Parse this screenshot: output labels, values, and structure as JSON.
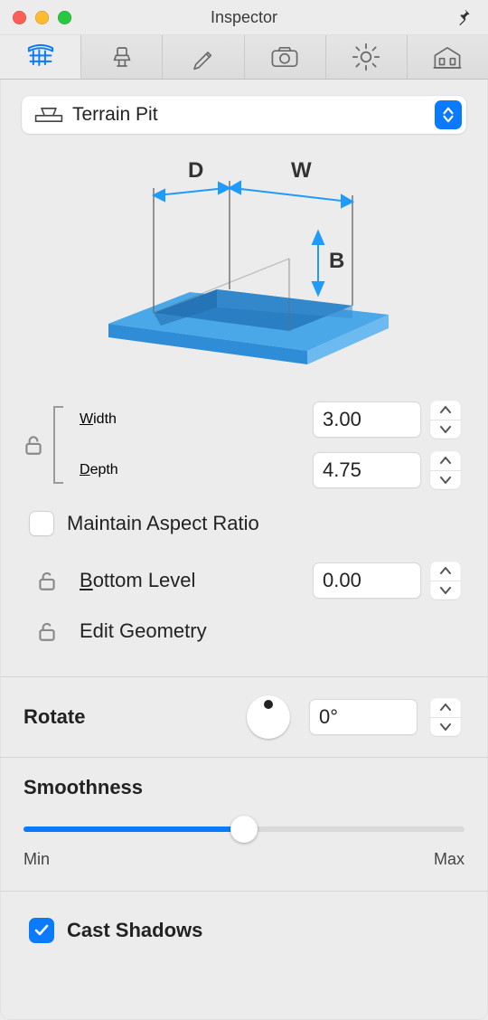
{
  "window": {
    "title": "Inspector"
  },
  "object": {
    "name": "Terrain Pit"
  },
  "diagram": {
    "d_label": "D",
    "w_label": "W",
    "b_label": "B"
  },
  "width": {
    "label_pre": "W",
    "label_rest": "idth",
    "value": "3.00"
  },
  "depth": {
    "label_pre": "D",
    "label_rest": "epth",
    "value": "4.75"
  },
  "aspect": {
    "label": "Maintain Aspect Ratio",
    "checked": false
  },
  "bottom": {
    "label_pre": "B",
    "label_rest": "ottom Level",
    "value": "0.00"
  },
  "edit_geometry": {
    "label": "Edit Geometry"
  },
  "rotate": {
    "label": "Rotate",
    "value": "0°",
    "angle_deg": 0
  },
  "smoothness": {
    "label": "Smoothness",
    "min_label": "Min",
    "max_label": "Max",
    "value_pct": 50
  },
  "cast_shadows": {
    "label": "Cast Shadows",
    "checked": true
  }
}
